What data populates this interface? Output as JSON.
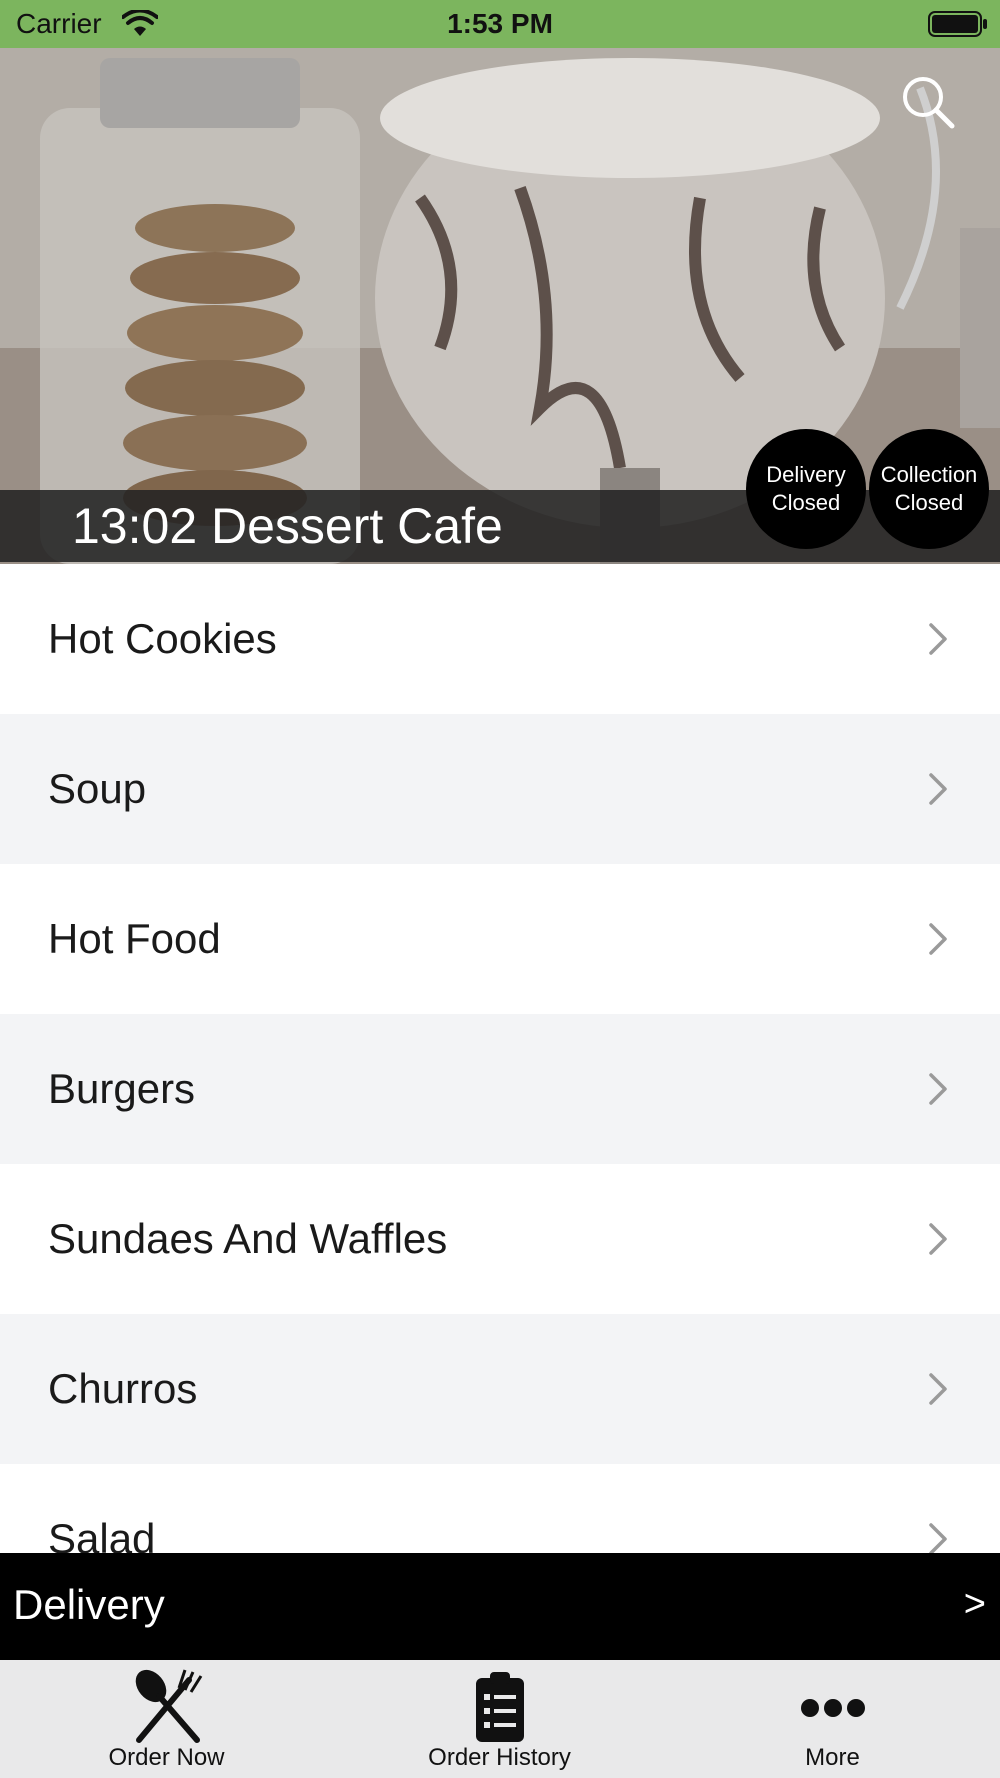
{
  "status_bar": {
    "carrier": "Carrier",
    "time": "1:53 PM"
  },
  "hero": {
    "restaurant_name": "13:02 Dessert Cafe",
    "badges": [
      {
        "line1": "Delivery",
        "line2": "Closed"
      },
      {
        "line1": "Collection",
        "line2": "Closed"
      }
    ]
  },
  "menu": {
    "items": [
      {
        "label": "Hot Cookies"
      },
      {
        "label": "Soup"
      },
      {
        "label": "Hot Food"
      },
      {
        "label": "Burgers"
      },
      {
        "label": "Sundaes And Waffles"
      },
      {
        "label": "Churros"
      },
      {
        "label": "Salad"
      }
    ]
  },
  "delivery_bar": {
    "label": "Delivery",
    "arrow": ">"
  },
  "tab_bar": {
    "tabs": [
      {
        "label": "Order Now",
        "icon": "fork-knife-icon"
      },
      {
        "label": "Order History",
        "icon": "clipboard-list-icon"
      },
      {
        "label": "More",
        "icon": "more-dots-icon"
      }
    ]
  },
  "colors": {
    "status_bar": "#7cb55e",
    "badge": "#000000",
    "delivery_bar": "#000000",
    "tab_bar": "#e9e9ea",
    "row_alt": "#f3f4f6"
  }
}
